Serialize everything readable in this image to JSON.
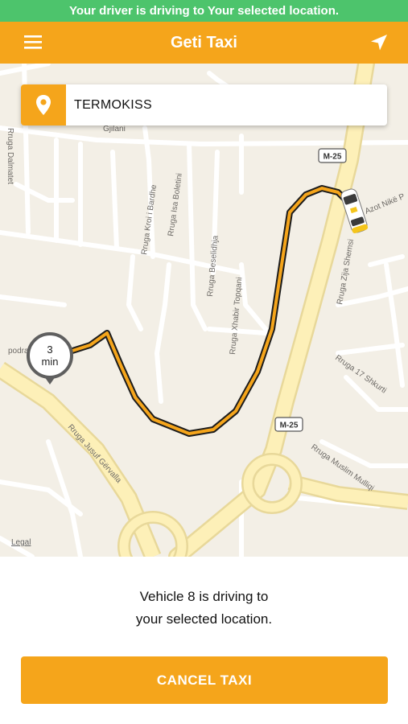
{
  "status_banner": "Your driver is driving to Your selected location.",
  "header": {
    "title": "Geti Taxi",
    "menu_icon": "hamburger-menu-icon",
    "locate_icon": "location-arrow-icon"
  },
  "search": {
    "value": "TERMOKISS",
    "icon": "map-pin-icon"
  },
  "map": {
    "road_labels": {
      "dalmateti": "Rruga Dalmatet",
      "kroi": "Rruga Kroi i Bardhe",
      "isa": "Rruga Isa Boletini",
      "beselidhja": "Rruga Beselidhja",
      "xhabir": "Rruga Xhabir Topqani",
      "zija": "Rruga Zija Shemsi",
      "nike": "Azot Nikë P",
      "shkurti": "Rruga 17 Shkurti",
      "jusuf": "Rruga Jusuf Gërvalla",
      "muslim": "Rruga Muslim Mulliqi",
      "podra": "podra",
      "upper_fragment": "Gjilani"
    },
    "highway_shield": "M-25",
    "eta": {
      "value": "3",
      "unit": "min"
    },
    "legal": "Legal",
    "colors": {
      "route": "#f5a51b",
      "route_outline": "#1c1c1c",
      "highway": "#fbe9a8"
    }
  },
  "status_message": {
    "line1": "Vehicle 8 is driving to",
    "line2": "your selected location."
  },
  "cancel_button": "CANCEL TAXI"
}
